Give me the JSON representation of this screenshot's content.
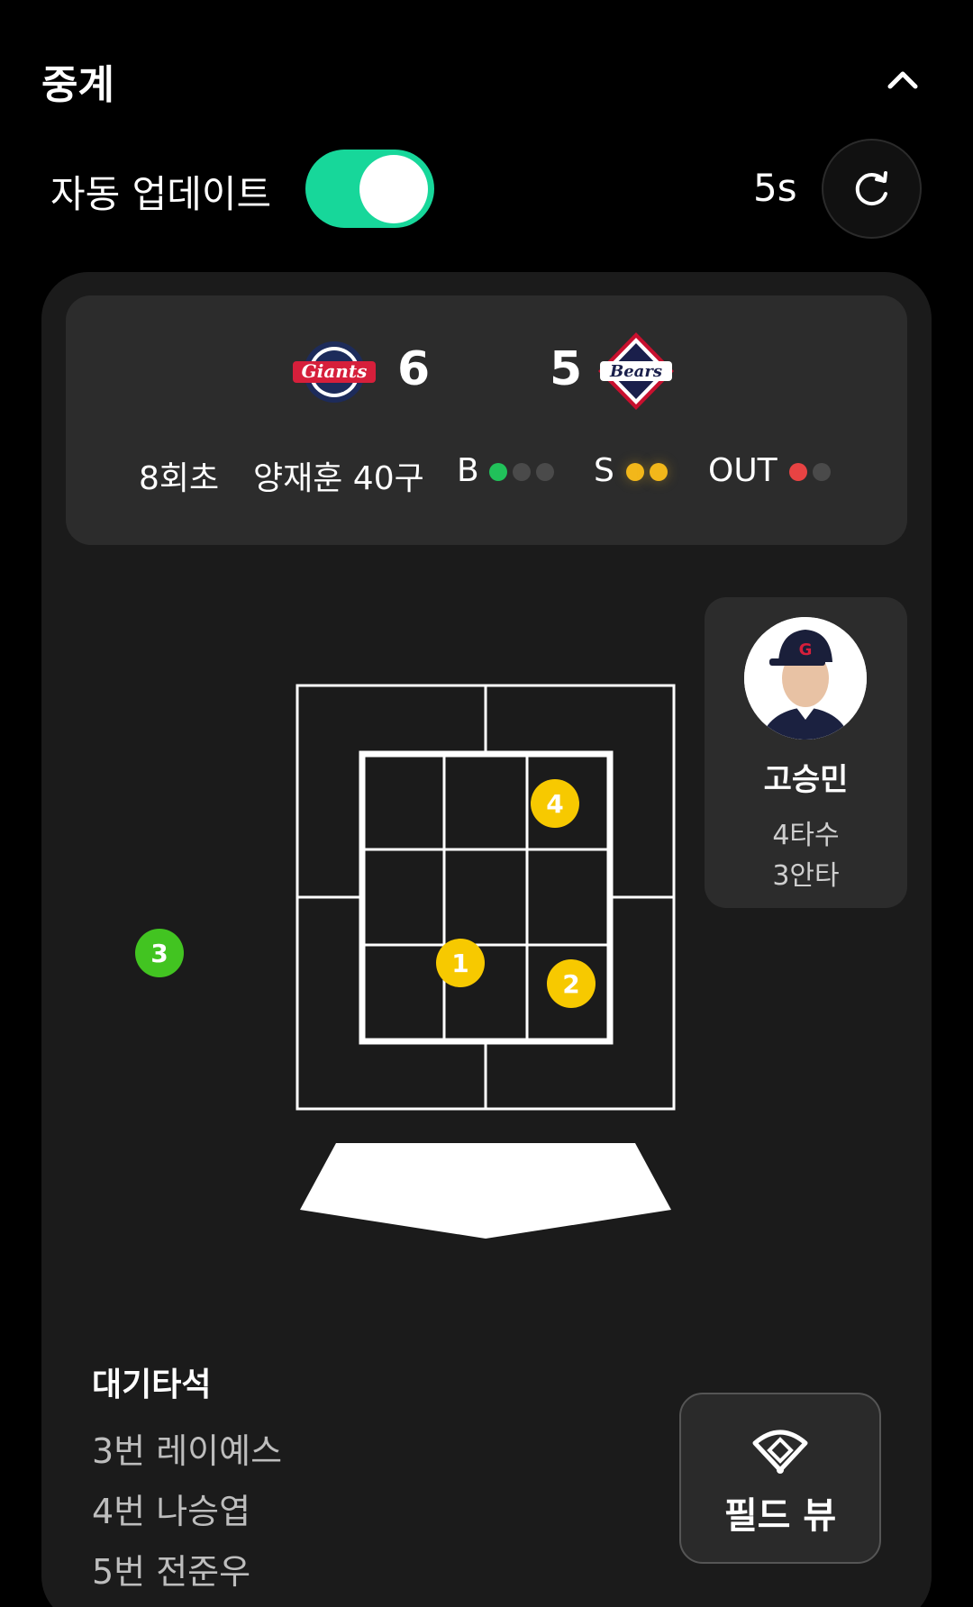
{
  "header": {
    "title": "중계"
  },
  "controls": {
    "auto_update_label": "자동 업데이트",
    "auto_update_on": true,
    "interval": "5s"
  },
  "scoreboard": {
    "home_score": "6",
    "away_score": "5",
    "home_logo_text": "Giants",
    "away_logo_text": "Bears",
    "inning": "8회초",
    "pitcher": "양재훈 40구",
    "balls_label": "B",
    "strikes_label": "S",
    "outs_label": "OUT",
    "balls": 1,
    "strikes": 2,
    "outs": 1
  },
  "pitches": [
    {
      "label": "1",
      "type": "strike"
    },
    {
      "label": "2",
      "type": "strike"
    },
    {
      "label": "3",
      "type": "ball"
    },
    {
      "label": "4",
      "type": "strike"
    }
  ],
  "batter": {
    "name": "고승민",
    "at_bats": "4타수",
    "hits": "3안타"
  },
  "on_deck": {
    "title": "대기타석",
    "items": [
      "3번 레이예스",
      "4번 나승엽",
      "5번 전준우"
    ]
  },
  "field_view": {
    "label": "필드 뷰"
  },
  "colors": {
    "toggle": "#17d79a",
    "ball": "#21c15a",
    "strike": "#f2b71a",
    "out": "#e84343"
  }
}
